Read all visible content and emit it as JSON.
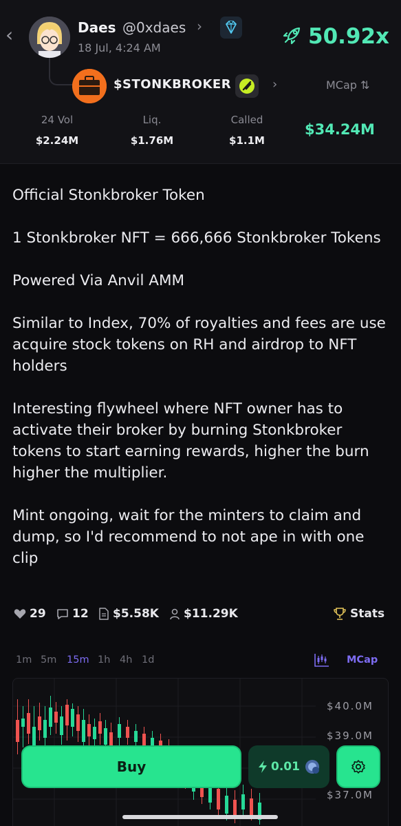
{
  "header": {
    "author_name": "Daes",
    "author_handle": "@0xdaes",
    "timestamp": "18 Jul, 4:24 AM",
    "multiplier": "50.92x",
    "token_ticker": "$STONKBROKER",
    "mcap_toggle_label": "MCap ⇅",
    "stats": [
      {
        "label": "24 Vol",
        "value": "$2.24M"
      },
      {
        "label": "Liq.",
        "value": "$1.76M"
      },
      {
        "label": "Called",
        "value": "$1.1M"
      }
    ],
    "market_cap": "$34.24M"
  },
  "post": {
    "paragraphs": [
      "Official Stonkbroker Token",
      "1 Stonkbroker NFT = 666,666 Stonkbroker Tokens",
      "Powered Via Anvil AMM",
      "Similar to Index, 70% of royalties and fees are use acquire stock tokens on RH and airdrop to NFT holders",
      "Interesting flywheel where NFT owner has to activate their broker by burning Stonkbroker tokens to start earning rewards, higher the burn higher the multiplier.",
      "Mint ongoing, wait for the minters to claim and dump, so I'd recommend to not ape in with one clip"
    ]
  },
  "engagement": {
    "likes": "29",
    "comments": "12",
    "doc_value": "$5.58K",
    "user_value": "$11.29K",
    "stats_label": "Stats"
  },
  "chart_controls": {
    "timeframes": [
      "1m",
      "5m",
      "15m",
      "1h",
      "4h",
      "1d"
    ],
    "active_timeframe": "15m",
    "metric": "MCap"
  },
  "chart_data": {
    "type": "candlestick",
    "y_tick_labels": [
      "$40.0M",
      "$39.0M",
      "$37.0M"
    ],
    "up_color": "#26d997",
    "down_color": "#ef5350"
  },
  "actions": {
    "buy_label": "Buy",
    "amount": "0.01"
  },
  "icons": {
    "back": "chevron-left-icon",
    "verified": "diamond-icon",
    "multiplier": "rocket-icon",
    "likes": "heart-icon",
    "comments": "comment-icon",
    "doc": "document-icon",
    "user": "user-icon",
    "stats": "trophy-icon",
    "settings": "gear-icon"
  },
  "colors": {
    "accent_green": "#52e8b5",
    "buy_green": "#27e48f",
    "purple": "#7d6cf2"
  }
}
